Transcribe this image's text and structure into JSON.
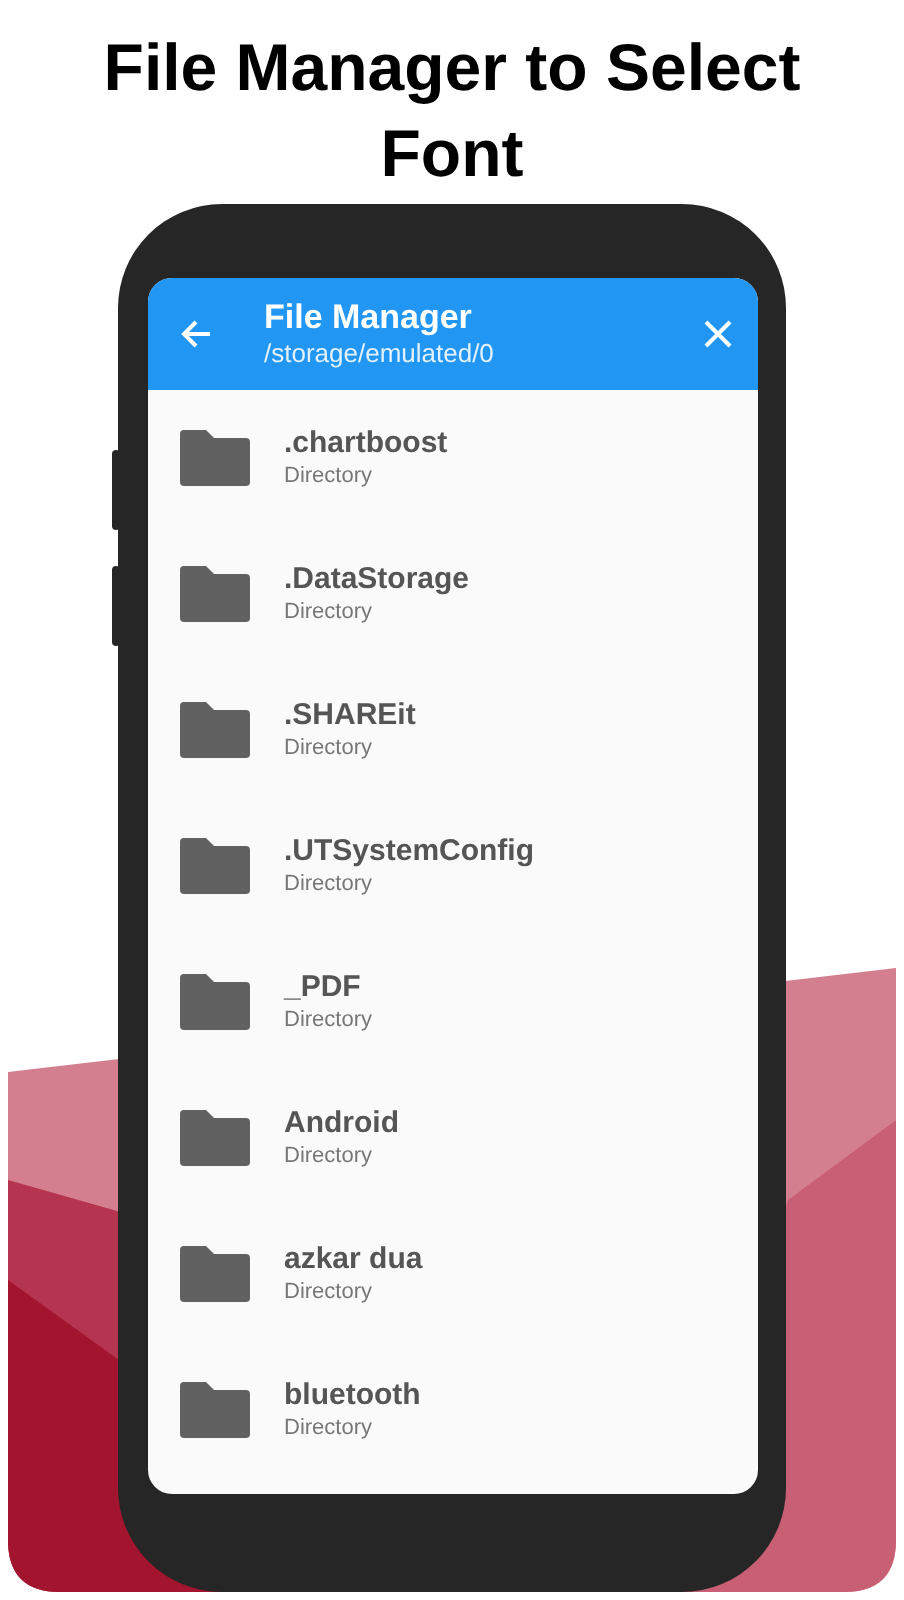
{
  "headline": "File Manager to Select Font",
  "app_bar": {
    "title": "File Manager",
    "path": "/storage/emulated/0"
  },
  "entries": [
    {
      "name": ".chartboost",
      "type": "Directory"
    },
    {
      "name": ".DataStorage",
      "type": "Directory"
    },
    {
      "name": ".SHAREit",
      "type": "Directory"
    },
    {
      "name": ".UTSystemConfig",
      "type": "Directory"
    },
    {
      "name": "_PDF",
      "type": "Directory"
    },
    {
      "name": "Android",
      "type": "Directory"
    },
    {
      "name": "azkar dua",
      "type": "Directory"
    },
    {
      "name": "bluetooth",
      "type": "Directory"
    }
  ]
}
